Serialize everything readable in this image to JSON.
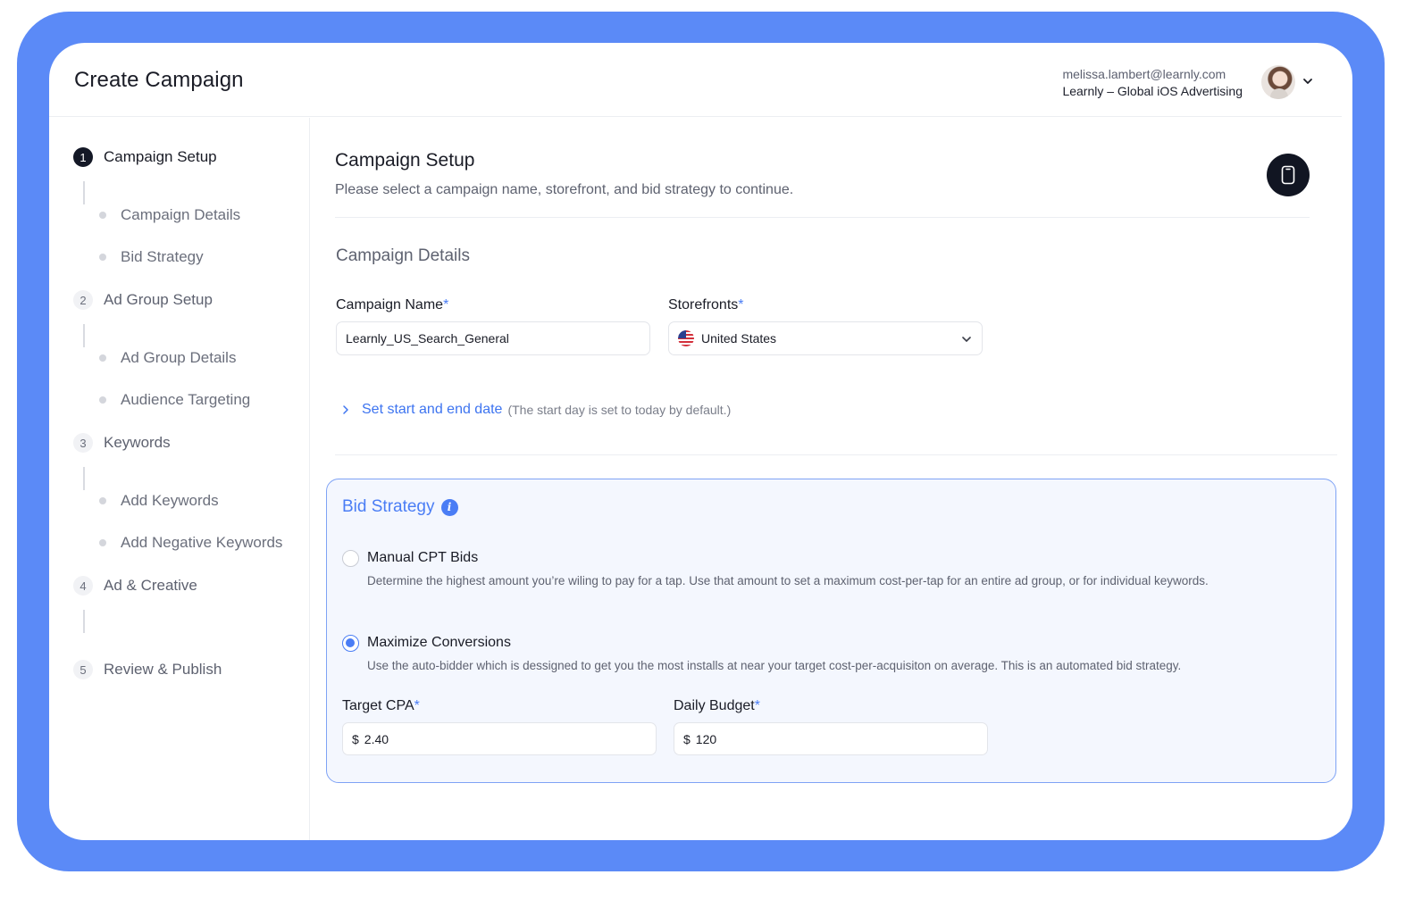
{
  "header": {
    "title": "Create Campaign",
    "account_email": "melissa.lambert@learnly.com",
    "account_org": "Learnly – Global iOS Advertising"
  },
  "sidebar": {
    "steps": [
      {
        "num": "1",
        "label": "Campaign Setup",
        "active": true,
        "subs": [
          "Campaign Details",
          "Bid Strategy"
        ]
      },
      {
        "num": "2",
        "label": "Ad Group Setup",
        "active": false,
        "subs": [
          "Ad Group Details",
          "Audience Targeting"
        ]
      },
      {
        "num": "3",
        "label": "Keywords",
        "active": false,
        "subs": [
          "Add Keywords",
          "Add Negative Keywords"
        ]
      },
      {
        "num": "4",
        "label": "Ad & Creative",
        "active": false,
        "subs": []
      },
      {
        "num": "5",
        "label": "Review & Publish",
        "active": false,
        "subs": []
      }
    ]
  },
  "main": {
    "title": "Campaign Setup",
    "subtitle": "Please select a campaign name, storefront, and bid strategy to continue.",
    "section_title": "Campaign Details",
    "campaign_name_label": "Campaign Name",
    "campaign_name_value": "Learnly_US_Search_General",
    "storefronts_label": "Storefronts",
    "storefront_value": "United States",
    "required_mark": "*",
    "date_link": "Set start and end date",
    "date_hint": "(The start day is set to today by default.)",
    "bid": {
      "title": "Bid Strategy",
      "info_glyph": "i",
      "options": [
        {
          "title": "Manual CPT Bids",
          "desc": "Determine the highest amount you’re wiling to pay for a tap. Use that amount to set a maximum cost-per-tap for an entire ad group, or for individual keywords.",
          "checked": false
        },
        {
          "title": "Maximize Conversions",
          "desc": "Use the auto-bidder which is dessigned to get you the most installs at near your target cost-per-acquisiton on average. This is an automated bid strategy.",
          "checked": true
        }
      ],
      "target_cpa_label": "Target CPA",
      "target_cpa_currency": "$",
      "target_cpa_value": "2.40",
      "daily_budget_label": "Daily Budget",
      "daily_budget_currency": "$",
      "daily_budget_value": "120"
    }
  },
  "colors": {
    "frame": "#5b8af7",
    "accent": "#4a7df5",
    "dark": "#141826"
  },
  "icons": {
    "account_menu": "chevron-down-icon",
    "device_preview": "phone-icon",
    "storefront_flag": "us-flag-icon",
    "storefront_dropdown": "chevron-down-icon",
    "date_toggle": "chevron-right-icon",
    "bid_info": "info-icon"
  }
}
